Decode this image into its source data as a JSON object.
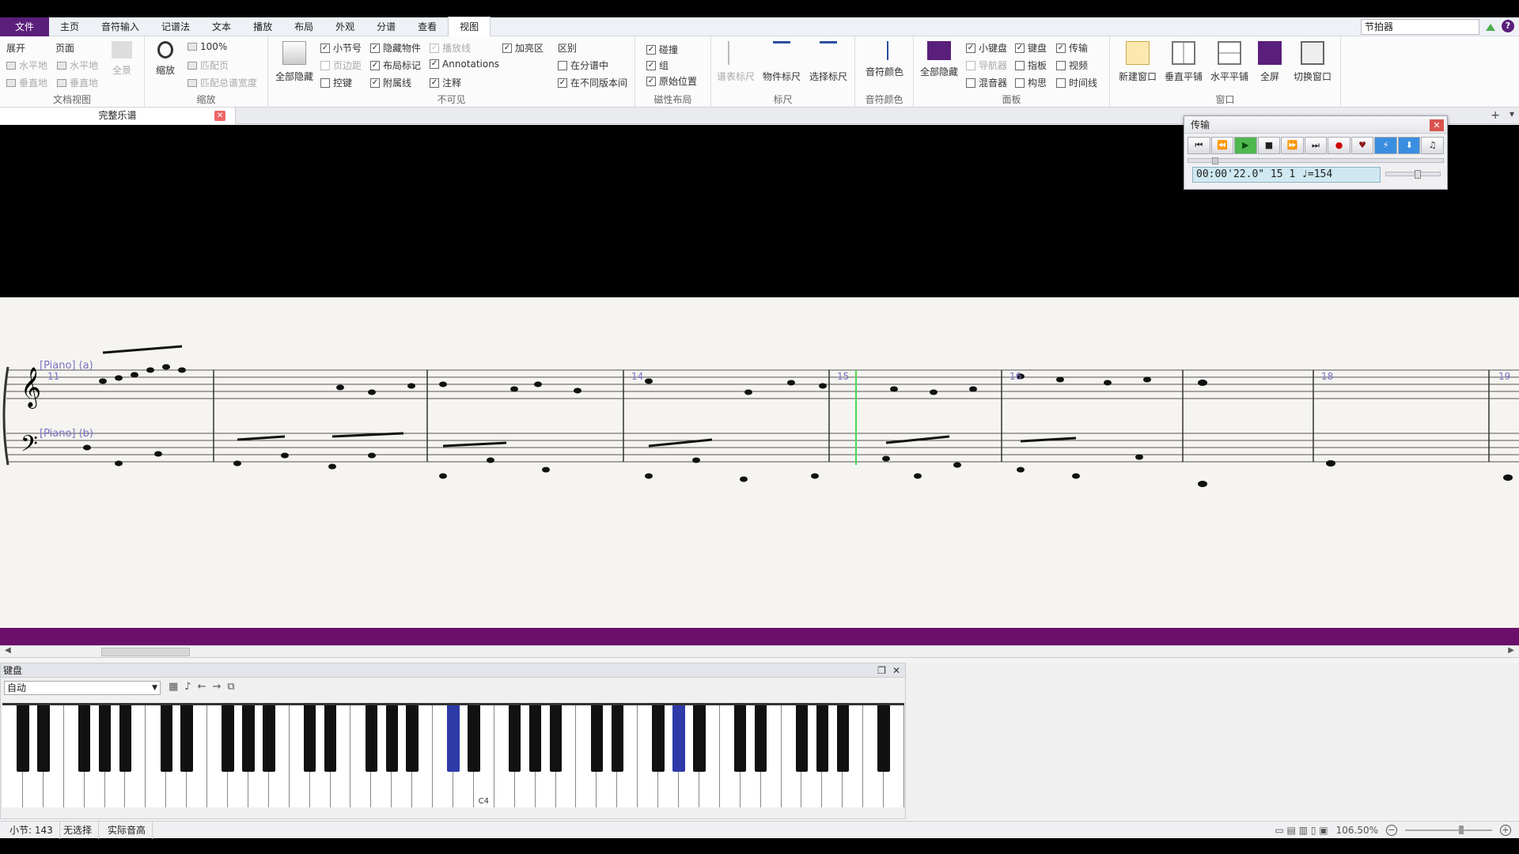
{
  "menubar": {
    "items": [
      "文件",
      "主页",
      "音符输入",
      "记谱法",
      "文本",
      "播放",
      "布局",
      "外观",
      "分谱",
      "查看",
      "视图"
    ],
    "search_value": "节拍器"
  },
  "ribbon": {
    "doc_view": {
      "label": "文档视图",
      "buttons": [
        "展开",
        "页面",
        "水平地",
        "水平地",
        "全景",
        "垂直地",
        "垂直地"
      ]
    },
    "zoom": {
      "label": "缩放",
      "zoom_btn": "缩放",
      "percent": "100%",
      "fit_page": "匹配页",
      "fit_width": "匹配总谱宽度"
    },
    "invisibles": {
      "label": "不可见",
      "hide_all": "全部隐藏",
      "checks": [
        {
          "text": "小节号",
          "checked": true,
          "dim": false
        },
        {
          "text": "隐藏物件",
          "checked": true,
          "dim": false
        },
        {
          "text": "播放线",
          "checked": true,
          "dim": true
        },
        {
          "text": "加亮区",
          "checked": true,
          "dim": false
        },
        {
          "text": "区别",
          "checked": false,
          "dim": false
        },
        {
          "text": "页边距",
          "checked": false,
          "dim": true
        },
        {
          "text": "布局标记",
          "checked": true,
          "dim": false
        },
        {
          "text": "Annotations",
          "checked": true,
          "dim": false
        },
        {
          "text": "在分谱中",
          "checked": false,
          "dim": false
        },
        {
          "text": "控键",
          "checked": false,
          "dim": false
        },
        {
          "text": "附属线",
          "checked": true,
          "dim": false
        },
        {
          "text": "注释",
          "checked": true,
          "dim": false
        },
        {
          "text": "在不同版本间",
          "checked": true,
          "dim": false
        }
      ]
    },
    "magnetic": {
      "label": "磁性布局",
      "checks": [
        {
          "text": "碰撞",
          "checked": true
        },
        {
          "text": "组",
          "checked": true
        },
        {
          "text": "原始位置",
          "checked": true
        }
      ]
    },
    "rulers": {
      "label": "标尺",
      "buttons": [
        "谱表标尺",
        "物件标尺",
        "选择标尺"
      ]
    },
    "note_colors": {
      "label": "音符颜色",
      "button": "音符颜色"
    },
    "panels": {
      "label": "面板",
      "hide_all": "全部隐藏",
      "checks": [
        {
          "text": "小键盘",
          "checked": true,
          "dim": false
        },
        {
          "text": "键盘",
          "checked": true,
          "dim": false
        },
        {
          "text": "传输",
          "checked": true,
          "dim": false
        },
        {
          "text": "导航器",
          "checked": false,
          "dim": true
        },
        {
          "text": "指板",
          "checked": false,
          "dim": false
        },
        {
          "text": "视频",
          "checked": false,
          "dim": false
        },
        {
          "text": "混音器",
          "checked": false,
          "dim": false
        },
        {
          "text": "构思",
          "checked": false,
          "dim": false
        },
        {
          "text": "时间线",
          "checked": false,
          "dim": false
        }
      ]
    },
    "window": {
      "label": "窗口",
      "buttons": [
        "新建窗口",
        "垂直平铺",
        "水平平铺",
        "全屏",
        "切换窗口"
      ]
    }
  },
  "tabs": {
    "doc_tab": "完整乐谱"
  },
  "score": {
    "staff_labels": [
      "[Piano] (a)",
      "[Piano] (b)"
    ],
    "bar_numbers": [
      "11",
      "14",
      "15",
      "16",
      "18",
      "19"
    ]
  },
  "transport": {
    "title": "传输",
    "buttons": [
      "⏮",
      "⏪",
      "▶",
      "■",
      "⏩",
      "⏭",
      "●",
      "♥",
      "⚡",
      "⬇",
      "♫"
    ],
    "display": "00:00'22.0\" 15   1    ♩=154"
  },
  "keyboard": {
    "title": "键盘",
    "mode": "自动",
    "c4_label": "C4"
  },
  "status": {
    "bar": "小节: 143",
    "selection": "无选择",
    "pitch": "实际音高",
    "zoom": "106.50%"
  },
  "colors": {
    "accent": "#5a1f7a",
    "highlight_key": "#2d3aa8",
    "playline": "#4cd94c",
    "score_bg": "#f6f4f0"
  }
}
